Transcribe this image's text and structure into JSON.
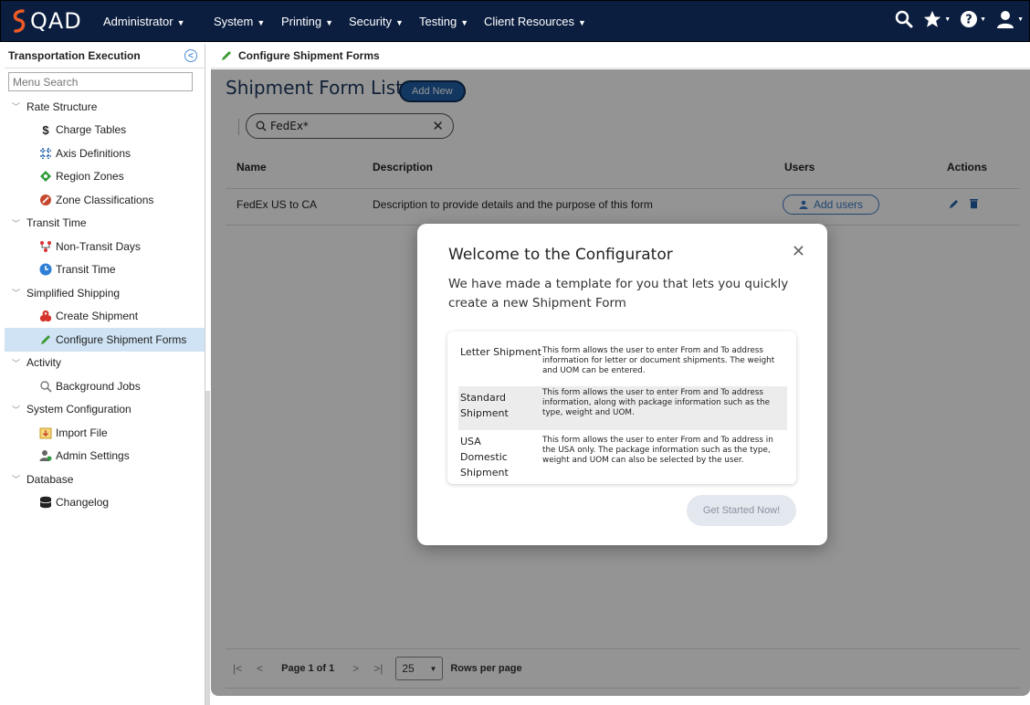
{
  "app": {
    "brand": "QAD",
    "role_menu": "Administrator",
    "menus": [
      "System",
      "Printing",
      "Security",
      "Testing",
      "Client Resources"
    ]
  },
  "sidebar": {
    "title": "Transportation Execution",
    "search_placeholder": "Menu Search",
    "groups": [
      {
        "label": "Rate Structure",
        "items": [
          {
            "label": "Charge Tables",
            "icon": "dollar-icon"
          },
          {
            "label": "Axis Definitions",
            "icon": "axis-icon"
          },
          {
            "label": "Region Zones",
            "icon": "region-icon"
          },
          {
            "label": "Zone Classifications",
            "icon": "zone-icon"
          }
        ]
      },
      {
        "label": "Transit Time",
        "items": [
          {
            "label": "Non-Transit Days",
            "icon": "calendar-off-icon"
          },
          {
            "label": "Transit Time",
            "icon": "clock-icon"
          }
        ]
      },
      {
        "label": "Simplified Shipping",
        "items": [
          {
            "label": "Create Shipment",
            "icon": "boxes-icon"
          },
          {
            "label": "Configure Shipment Forms",
            "icon": "pencil-icon",
            "active": true
          }
        ]
      },
      {
        "label": "Activity",
        "items": [
          {
            "label": "Background Jobs",
            "icon": "magnifier-icon"
          }
        ]
      },
      {
        "label": "System Configuration",
        "items": [
          {
            "label": "Import File",
            "icon": "import-icon"
          },
          {
            "label": "Admin Settings",
            "icon": "admin-icon"
          }
        ]
      },
      {
        "label": "Database",
        "items": [
          {
            "label": "Changelog",
            "icon": "database-icon"
          }
        ]
      }
    ]
  },
  "breadcrumb": "Configure Shipment Forms",
  "page": {
    "title": "Shipment Form List",
    "add_new": "Add New",
    "search_value": "FedEx*",
    "columns": [
      "Name",
      "Description",
      "Users",
      "Actions"
    ],
    "rows": [
      {
        "name": "FedEx US to CA",
        "description": "Description to provide details and the purpose of this form",
        "users_button": "Add users"
      }
    ],
    "pager": {
      "page_text": "Page 1 of 1",
      "rows_per_page_value": "25",
      "rows_per_page_label": "Rows per page"
    }
  },
  "modal": {
    "title": "Welcome to the Configurator",
    "subtitle": "We have made a template for you that lets you quickly create a new Shipment Form",
    "options": [
      {
        "name": "Letter Shipment",
        "desc": "This form allows the user to enter From and To address information for letter or document shipments. The weight and UOM can be entered."
      },
      {
        "name": "Standard Shipment",
        "desc": "This form allows the user to enter From and To address information, along with package information such as the type, weight and UOM."
      },
      {
        "name": "USA Domestic Shipment",
        "desc": "This form allows the user to enter From and To address in the USA only. The package information such as the type, weight and UOM can also be selected by the user."
      }
    ],
    "cta": "Get Started Now!"
  },
  "colors": {
    "topbar": "#0b1e3f",
    "accent": "#1f5fa8",
    "active_item": "#cfe3f4",
    "logo_orange": "#f15a24"
  }
}
